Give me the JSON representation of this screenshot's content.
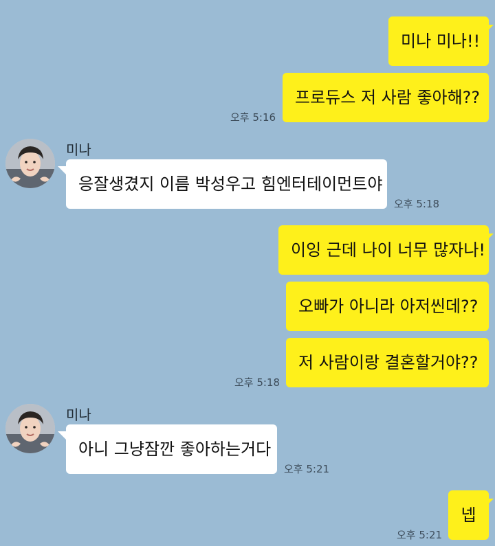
{
  "messages": {
    "m1": "미나 미나!!",
    "m2": "프로듀스 저 사람 좋아해??",
    "t1": "오후 5:16",
    "sender1": "미나",
    "m3": "응잘생겼지 이름 박성우고 힘엔터테이먼트야",
    "t2": "오후 5:18",
    "m4": "이잉 근데 나이 너무 많자나!",
    "m5": "오빠가 아니라 아저씬데??",
    "m6": "저 사람이랑 결혼할거야??",
    "t3": "오후 5:18",
    "sender2": "미나",
    "m7": "아니 그냥잠깐 좋아하는거다",
    "t4": "오후 5:21",
    "m8": "넵",
    "t5": "오후 5:21"
  },
  "colors": {
    "background": "#9bbbd4",
    "outgoing_bubble": "#fef01b",
    "incoming_bubble": "#ffffff"
  },
  "icons": {
    "avatar": "profile-photo"
  }
}
